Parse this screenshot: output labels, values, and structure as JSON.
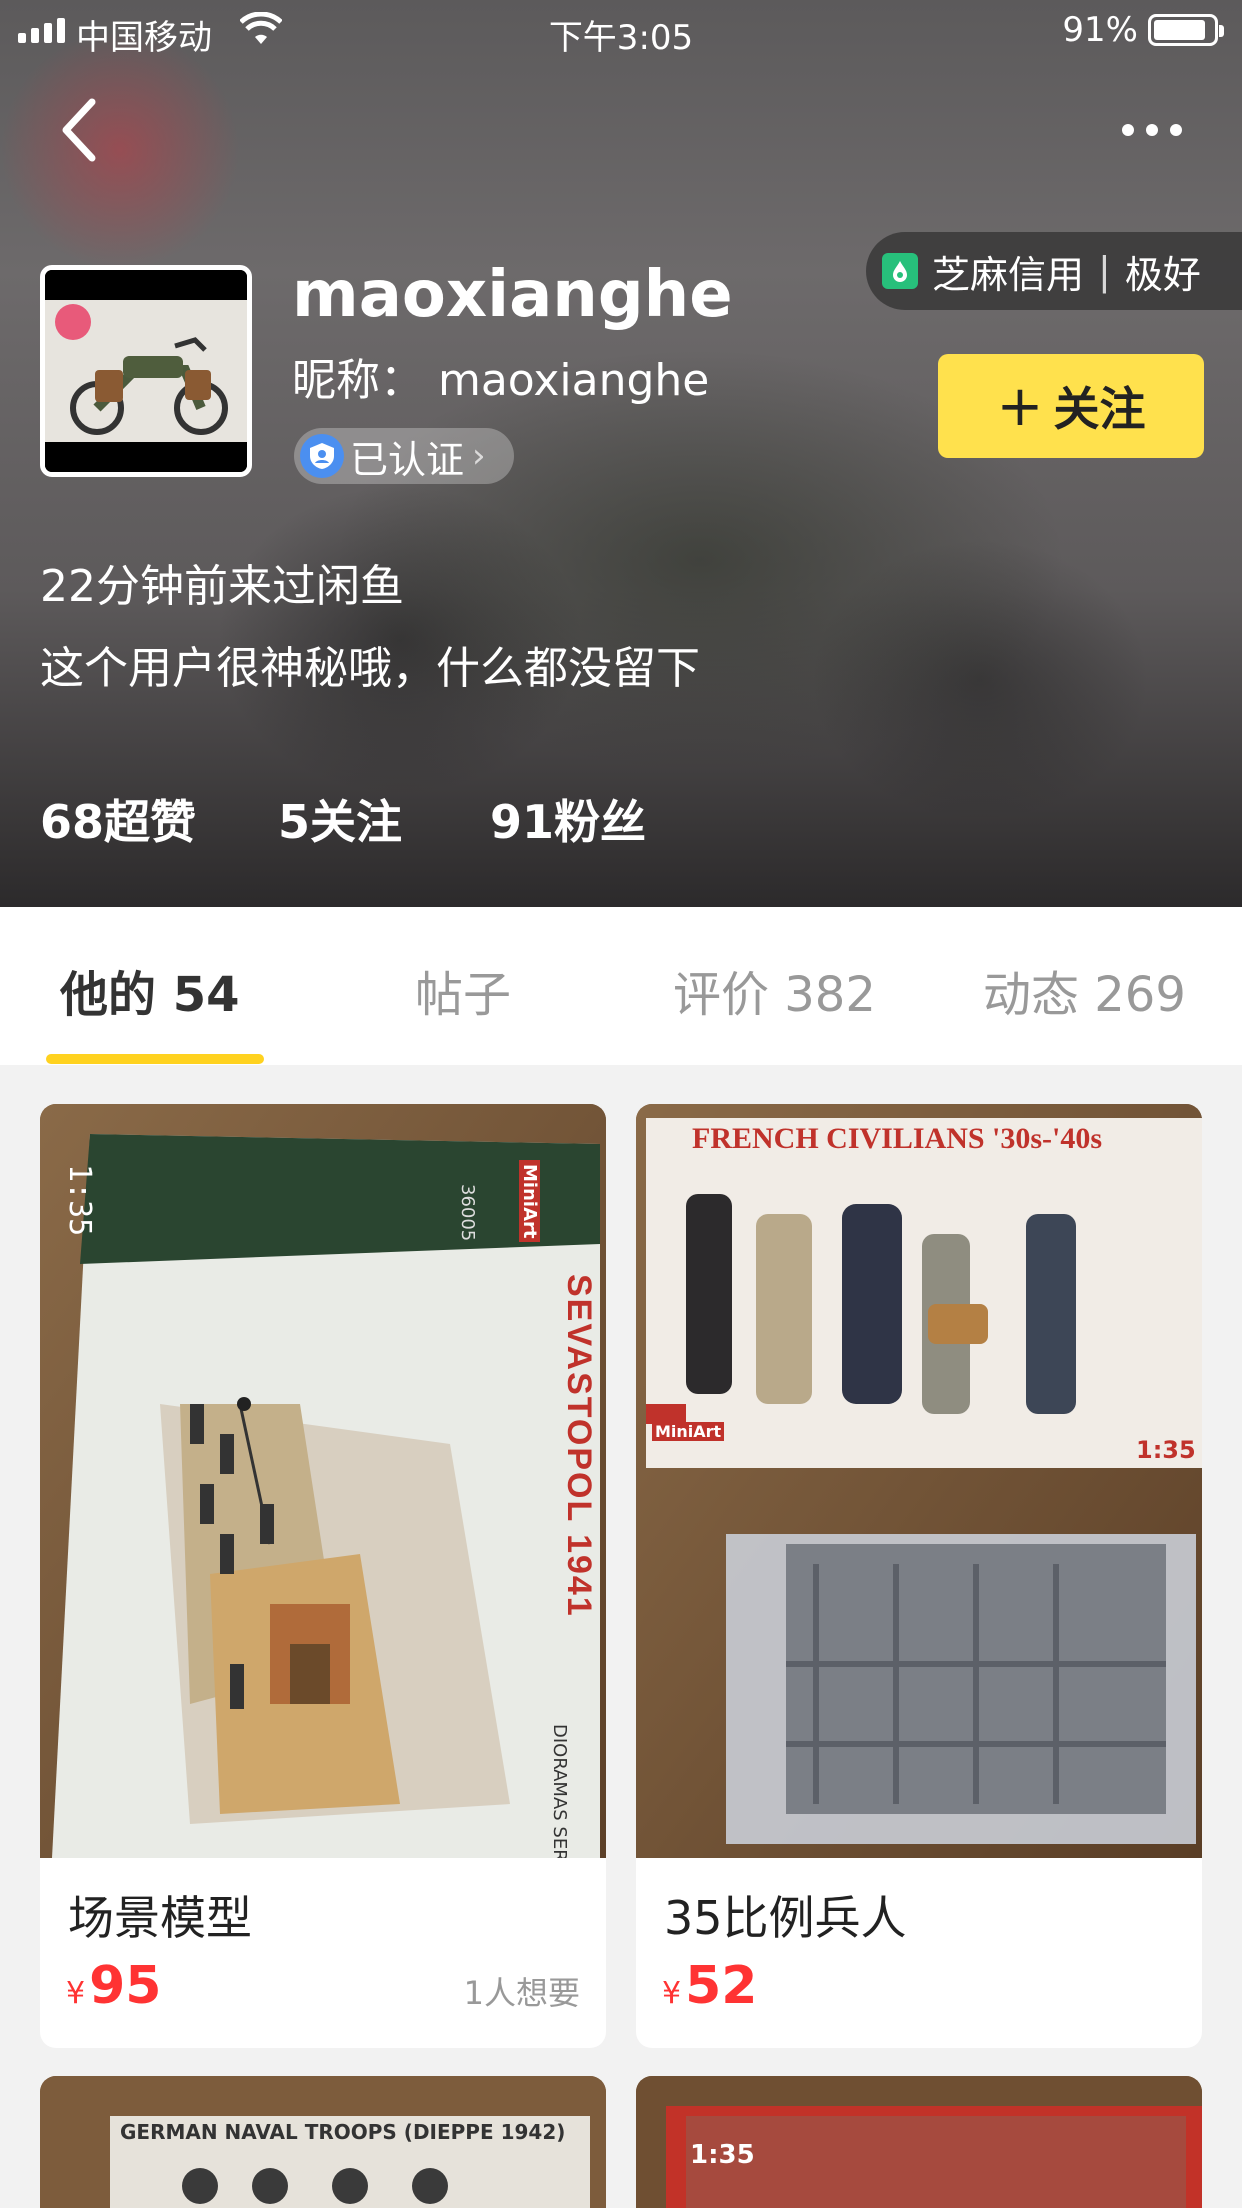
{
  "status_bar": {
    "carrier": "中国移动",
    "time": "下午3:05",
    "battery": "91%",
    "battery_level": 0.91
  },
  "profile": {
    "username": "maoxianghe",
    "nickname": "昵称：  maoxianghe",
    "verified_label": "已认证",
    "credit_label": "芝麻信用",
    "credit_value": "极好",
    "follow_label": "关注",
    "last_seen": "22分钟前来过闲鱼",
    "bio": "这个用户很神秘哦，什么都没留下",
    "stats": [
      {
        "value": "68",
        "label": "超赞"
      },
      {
        "value": "5",
        "label": "关注"
      },
      {
        "value": "91",
        "label": "粉丝"
      }
    ]
  },
  "tabs": [
    {
      "label": "他的 54",
      "active": true
    },
    {
      "label": "帖子",
      "active": false
    },
    {
      "label": "评价 382",
      "active": false
    },
    {
      "label": "动态 269",
      "active": false
    }
  ],
  "items": [
    {
      "title": "场景模型",
      "currency": "¥",
      "price": "95",
      "wants": "1人想要",
      "box_scale": "1:35",
      "box_title": "SEVASTOPOL 1941",
      "box_series": "DIORAMAS SERIES",
      "box_code": "36005",
      "brand": "MiniArt"
    },
    {
      "title": "35比例兵人",
      "currency": "¥",
      "price": "52",
      "wants": "",
      "box_title": "FRENCH CIVILIANS '30s-'40s",
      "box_scale": "1:35",
      "brand": "MiniArt"
    },
    {
      "box_title": "GERMAN NAVAL TROOPS (DIEPPE 1942)"
    },
    {
      "box_title": "1:35"
    }
  ],
  "colors": {
    "accent": "#ffe14d",
    "tab_underline": "#ffd21f",
    "price": "#ff3333",
    "credit_green": "#27c07b",
    "verified_blue": "#4b8ff0"
  },
  "icons": [
    "back-icon",
    "more-icon",
    "wifi-icon",
    "battery-icon",
    "verified-icon",
    "sesame-credit-icon",
    "plus-icon",
    "chevron-right-icon"
  ]
}
